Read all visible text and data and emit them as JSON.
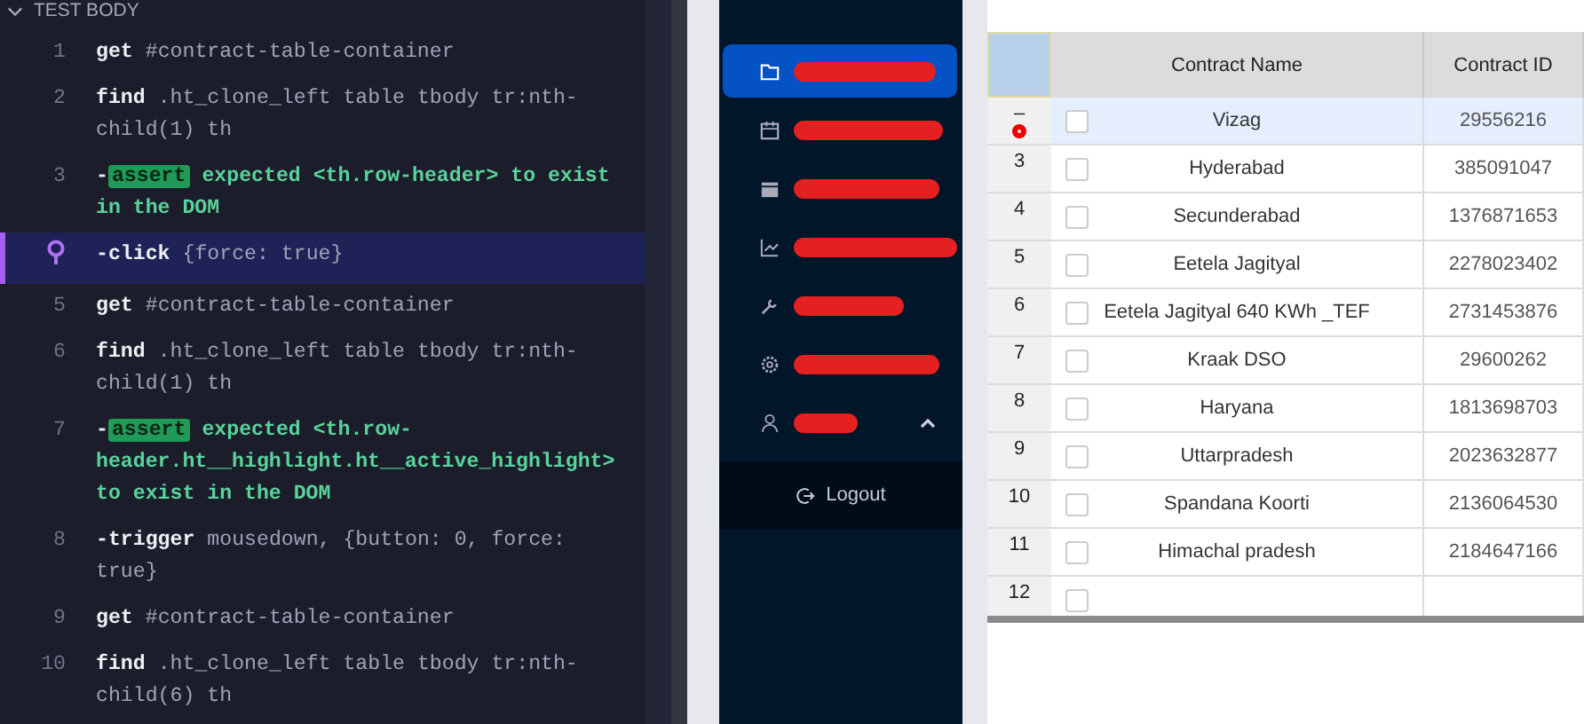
{
  "test_panel": {
    "section_title": "TEST BODY",
    "expanded": true,
    "commands": [
      {
        "number": "1",
        "kind": "command",
        "pinned": false,
        "name": "get",
        "args": "#contract-table-container"
      },
      {
        "number": "2",
        "kind": "command",
        "pinned": false,
        "name": "find",
        "args": ".ht_clone_left table tbody tr:nth-child(1) th"
      },
      {
        "number": "3",
        "kind": "assert",
        "pinned": false,
        "prefix": "-",
        "name": "assert",
        "args": "expected <th.row-header> to exist in the DOM"
      },
      {
        "kind": "command",
        "pinned": true,
        "prefix": "-",
        "name": "click",
        "args": "{force: true}"
      },
      {
        "number": "5",
        "kind": "command",
        "pinned": false,
        "name": "get",
        "args": "#contract-table-container"
      },
      {
        "number": "6",
        "kind": "command",
        "pinned": false,
        "name": "find",
        "args": ".ht_clone_left table tbody tr:nth-child(1) th"
      },
      {
        "number": "7",
        "kind": "assert",
        "pinned": false,
        "prefix": "-",
        "name": "assert",
        "args": "expected <th.row-header.ht__highlight.ht__active_highlight> to exist in the DOM"
      },
      {
        "number": "8",
        "kind": "command",
        "pinned": false,
        "prefix": "-",
        "name": "trigger",
        "args": "mousedown, {button: 0, force: true}"
      },
      {
        "number": "9",
        "kind": "command",
        "pinned": false,
        "name": "get",
        "args": "#contract-table-container"
      },
      {
        "number": "10",
        "kind": "command",
        "pinned": false,
        "name": "find",
        "args": ".ht_clone_left table tbody tr:nth-child(6) th"
      }
    ]
  },
  "sidebar": {
    "items": [
      {
        "kind": "folder",
        "selected": true,
        "expanded": false
      },
      {
        "kind": "calendar",
        "selected": false,
        "expanded": false
      },
      {
        "kind": "calendar-solid",
        "selected": false,
        "expanded": false
      },
      {
        "kind": "chart",
        "selected": false,
        "expanded": false
      },
      {
        "kind": "tools",
        "selected": false,
        "expanded": false
      },
      {
        "kind": "settings",
        "selected": false,
        "expanded": false
      },
      {
        "kind": "user",
        "selected": false,
        "expanded": true
      }
    ],
    "logout": "Logout"
  },
  "table": {
    "columns": [
      "Contract Name",
      "Contract ID"
    ],
    "row_headers": [
      "–",
      "3",
      "4",
      "5",
      "6",
      "7",
      "8",
      "9",
      "10",
      "11",
      "12"
    ],
    "rows": [
      {
        "name": "Vizag",
        "contract_id": "29556216",
        "selected": true,
        "checked": false
      },
      {
        "name": "Hyderabad",
        "contract_id": "385091047",
        "selected": false,
        "checked": false
      },
      {
        "name": "Secunderabad",
        "contract_id": "1376871653",
        "selected": false,
        "checked": false
      },
      {
        "name": "Eetela Jagityal",
        "contract_id": "2278023402",
        "selected": false,
        "checked": false
      },
      {
        "name": "Eetela Jagityal 640 KWh _TEF",
        "contract_id": "2731453876",
        "selected": false,
        "checked": false
      },
      {
        "name": "Kraak DSO",
        "contract_id": "29600262",
        "selected": false,
        "checked": false
      },
      {
        "name": "Haryana",
        "contract_id": "1813698703",
        "selected": false,
        "checked": false
      },
      {
        "name": "Uttarpradesh",
        "contract_id": "2023632877",
        "selected": false,
        "checked": false
      },
      {
        "name": "Spandana Koorti",
        "contract_id": "2136064530",
        "selected": false,
        "checked": false
      },
      {
        "name": "Himachal pradesh",
        "contract_id": "2184647166",
        "selected": false,
        "checked": false
      }
    ],
    "cut_row": {
      "checked": false
    }
  }
}
